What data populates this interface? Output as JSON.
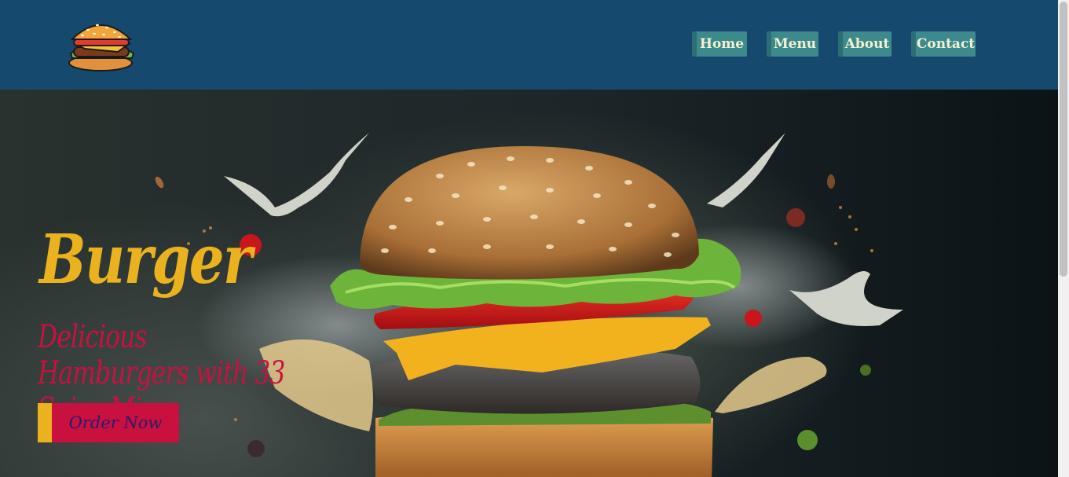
{
  "nav": {
    "logo_icon": "burger-logo-icon",
    "items": [
      {
        "label": "Home"
      },
      {
        "label": "Menu"
      },
      {
        "label": "About"
      },
      {
        "label": "Contact"
      }
    ]
  },
  "hero": {
    "title": "Burger",
    "subtitle": "Delicious Hamburgers with 33 Spicy Mix",
    "cta_label": "Order Now",
    "image": "flying-burger-illustration"
  },
  "colors": {
    "navbar": "#154a6e",
    "nav_button": "#3d8a8d",
    "title": "#eab21e",
    "accent": "#c8113f"
  }
}
